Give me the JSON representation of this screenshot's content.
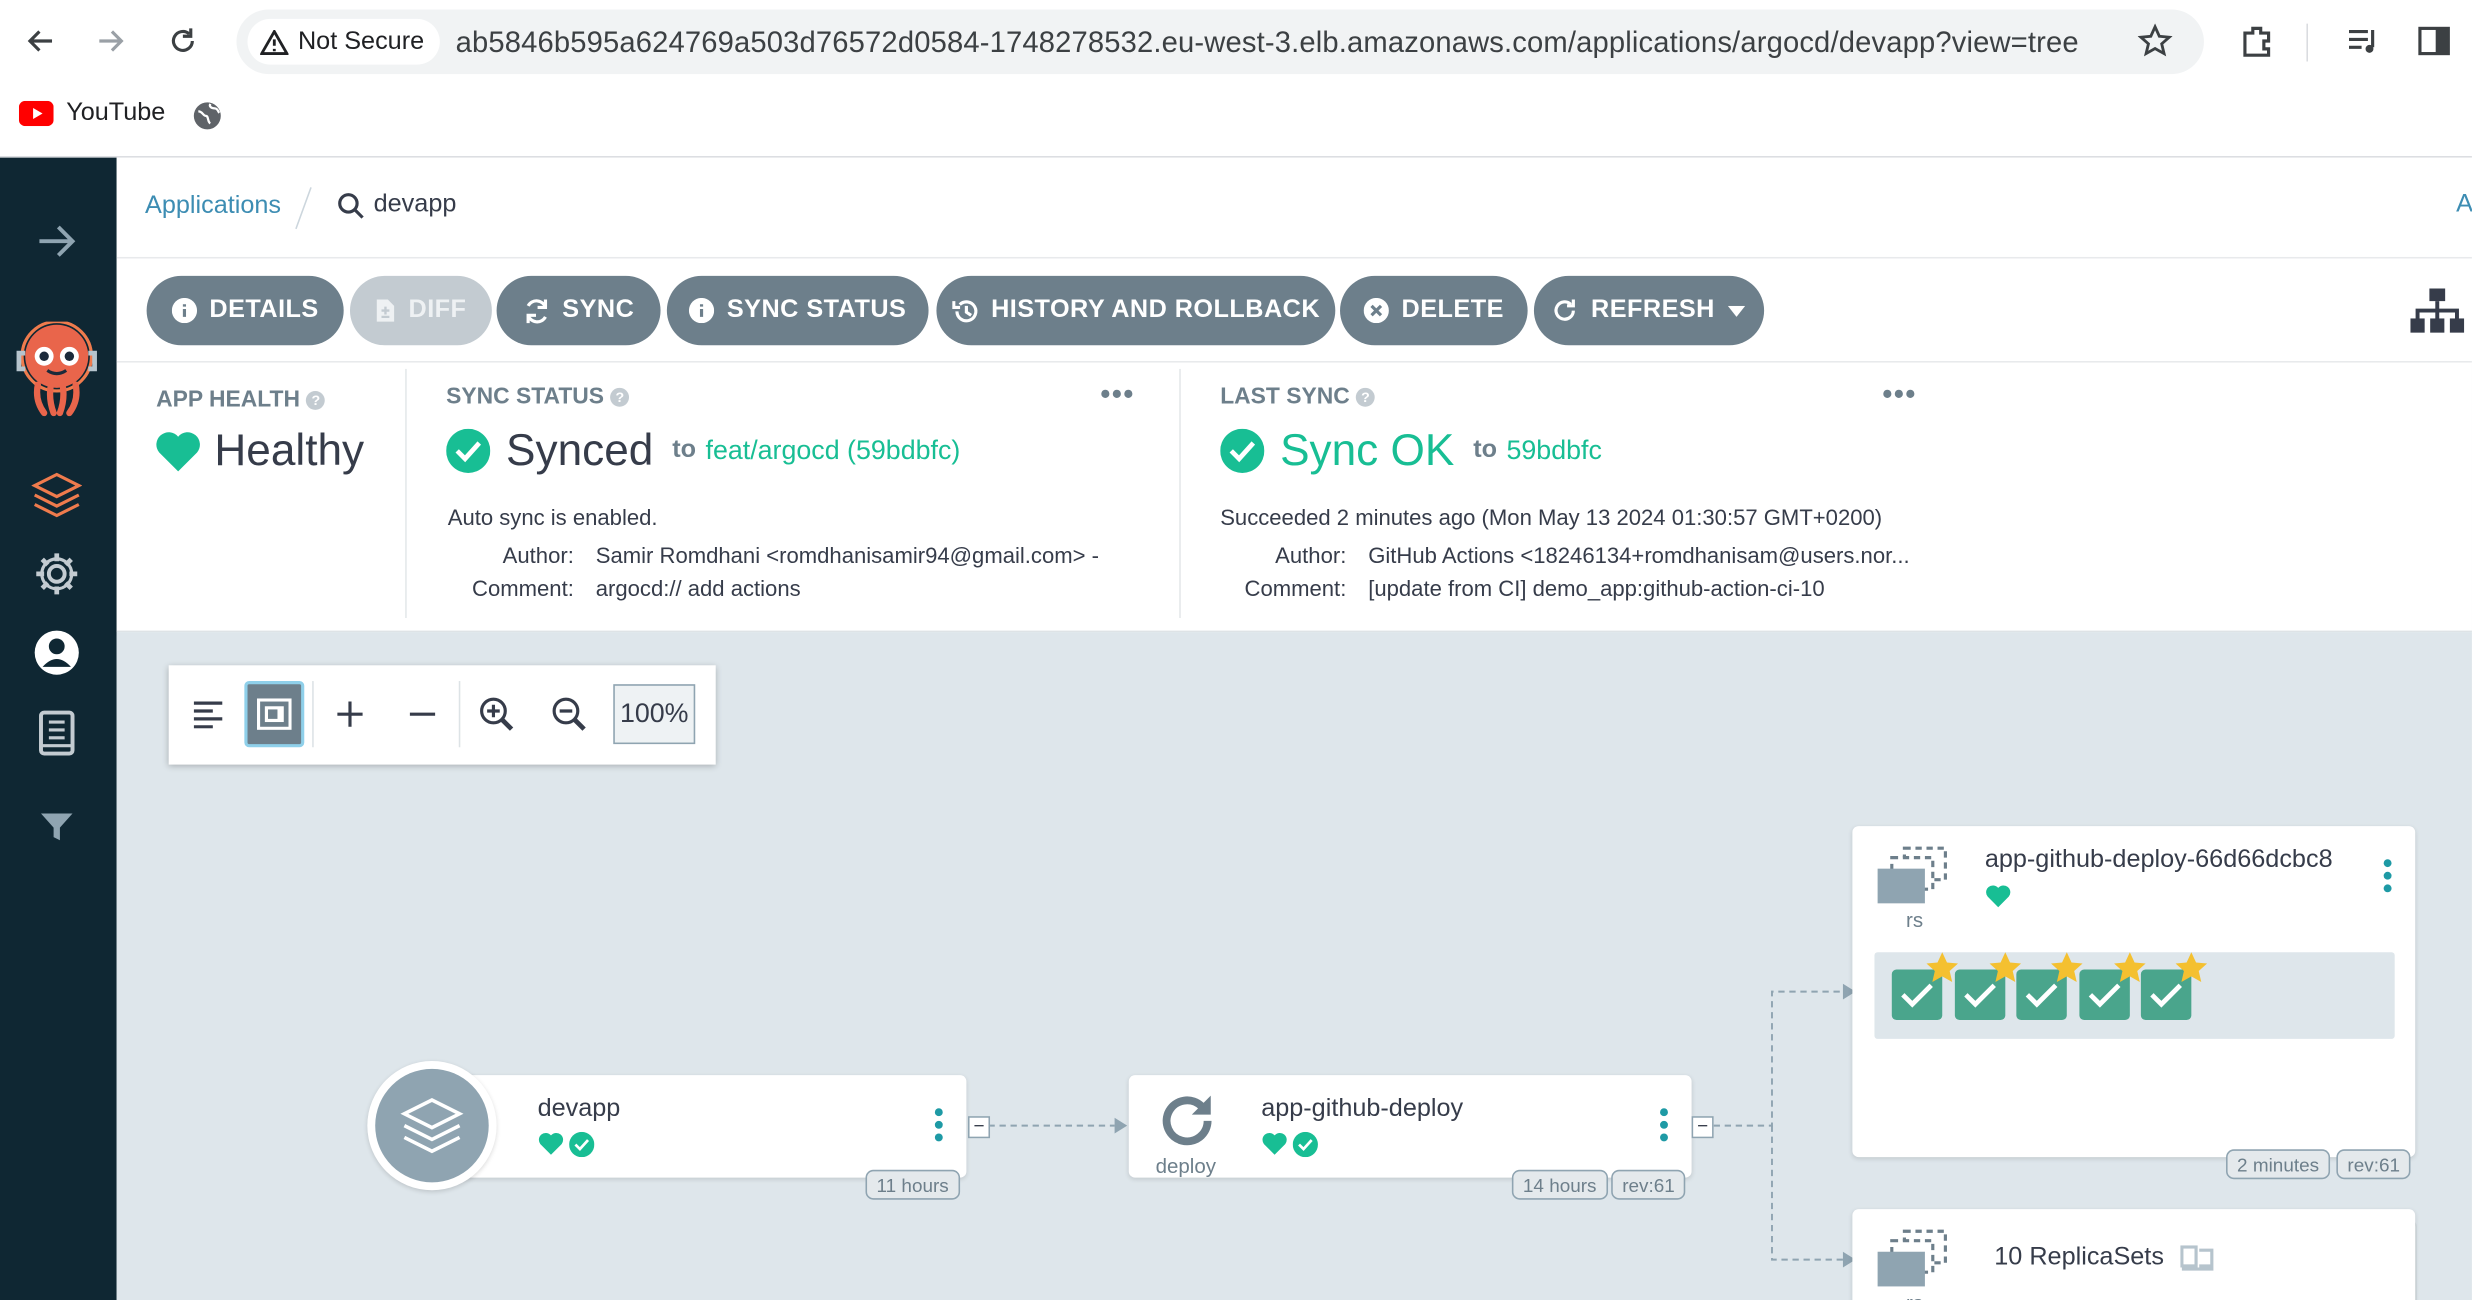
{
  "browser": {
    "security_label": "Not Secure",
    "url": "ab5846b595a624769a503d76572d0584-1748278532.eu-west-3.elb.amazonaws.com/applications/argocd/devapp?view=tree",
    "bookmarks": [
      {
        "label": "YouTube",
        "icon": "youtube-icon"
      },
      {
        "label": "",
        "icon": "globe-icon"
      }
    ]
  },
  "breadcrumb": {
    "root": "Applications",
    "current": "devapp",
    "right_cut": "A"
  },
  "actions": {
    "details": "DETAILS",
    "diff": "DIFF",
    "sync": "SYNC",
    "sync_status": "SYNC STATUS",
    "history": "HISTORY AND ROLLBACK",
    "delete": "DELETE",
    "refresh": "REFRESH"
  },
  "app_health": {
    "label": "APP HEALTH",
    "value": "Healthy"
  },
  "sync_status": {
    "label": "SYNC STATUS",
    "value": "Synced",
    "to": "to",
    "revision": "feat/argocd (59bdbfc)",
    "auto_sync": "Auto sync is enabled.",
    "author_key": "Author:",
    "author": "Samir Romdhani <romdhanisamir94@gmail.com> -",
    "comment_key": "Comment:",
    "comment": "argocd:// add actions"
  },
  "last_sync": {
    "label": "LAST SYNC",
    "value": "Sync OK",
    "to": "to",
    "revision": "59bdbfc",
    "succeeded": "Succeeded 2 minutes ago (Mon May 13 2024 01:30:57 GMT+0200)",
    "author_key": "Author:",
    "author": "GitHub Actions <18246134+romdhanisam@users.nor...",
    "comment_key": "Comment:",
    "comment": "[update from CI] demo_app:github-action-ci-10"
  },
  "canvas_controls": {
    "zoom": "100%"
  },
  "nodes": {
    "app": {
      "name": "devapp",
      "age": "11 hours"
    },
    "deploy": {
      "name": "app-github-deploy",
      "kind": "deploy",
      "age": "14 hours",
      "rev": "rev:61"
    },
    "rs": {
      "name": "app-github-deploy-66d66dcbc8",
      "kind": "rs",
      "age": "2 minutes",
      "rev": "rev:61",
      "pods": 5
    },
    "rs_group": {
      "name": "10 ReplicaSets",
      "kind": "rs"
    }
  },
  "colors": {
    "healthy": "#18be94",
    "button": "#6d7f8b",
    "link": "#3d8db3",
    "sidebar": "#0f2733",
    "canvas": "#dee6eb"
  }
}
